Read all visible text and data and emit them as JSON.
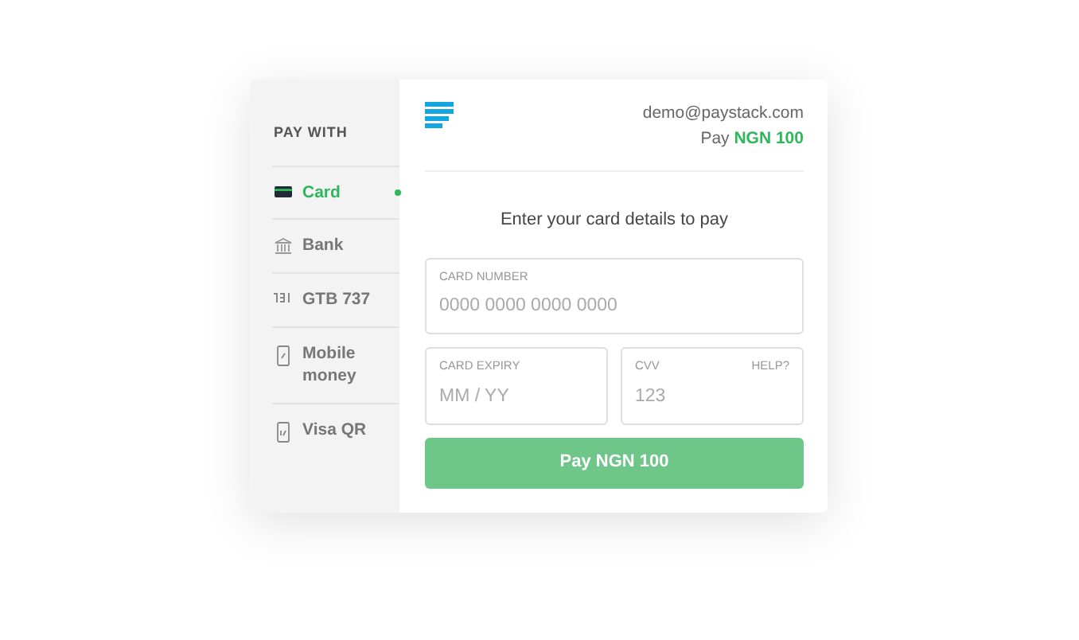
{
  "sidebar": {
    "title": "PAY WITH",
    "items": [
      {
        "label": "Card",
        "kind": "card",
        "selected": true
      },
      {
        "label": "Bank",
        "kind": "bank",
        "selected": false
      },
      {
        "label": "GTB 737",
        "kind": "ussd",
        "selected": false
      },
      {
        "label": "Mobile money",
        "kind": "phone",
        "selected": false
      },
      {
        "label": "Visa QR",
        "kind": "qr",
        "selected": false
      }
    ]
  },
  "header": {
    "email": "demo@paystack.com",
    "pay_label": "Pay",
    "amount": "NGN 100"
  },
  "prompt": "Enter your card details to pay",
  "fields": [
    {
      "label": "CARD NUMBER",
      "placeholder": "0000 0000 0000 0000"
    },
    {
      "label": "CARD EXPIRY",
      "placeholder": "MM / YY"
    },
    {
      "label": "CVV",
      "placeholder": "123",
      "help": "HELP?"
    }
  ],
  "pay_button": {
    "label": "Pay NGN 100",
    "disabled": true
  }
}
